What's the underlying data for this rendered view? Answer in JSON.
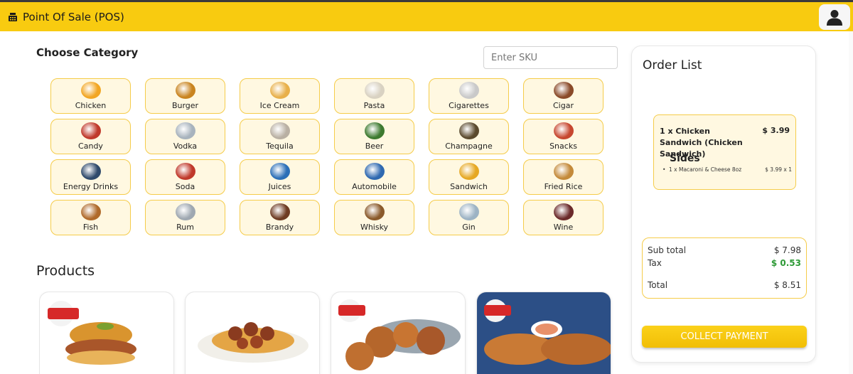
{
  "app": {
    "title": "Point Of Sale (POS)"
  },
  "categories_section": {
    "title": "Choose Category"
  },
  "search": {
    "placeholder": "Enter SKU",
    "value": ""
  },
  "categories": [
    {
      "label": "Chicken",
      "icon": "chicken-icon",
      "color": "#f2a623"
    },
    {
      "label": "Burger",
      "icon": "burger-icon",
      "color": "#c9841f"
    },
    {
      "label": "Ice Cream",
      "icon": "ice-cream-icon",
      "color": "#e8b04a"
    },
    {
      "label": "Pasta",
      "icon": "pasta-icon",
      "color": "#d9d2c2"
    },
    {
      "label": "Cigarettes",
      "icon": "cigarettes-icon",
      "color": "#c9c9c9"
    },
    {
      "label": "Cigar",
      "icon": "cigar-icon",
      "color": "#8a4a28"
    },
    {
      "label": "Candy",
      "icon": "candy-icon",
      "color": "#c0392b"
    },
    {
      "label": "Vodka",
      "icon": "vodka-icon",
      "color": "#a8b3bd"
    },
    {
      "label": "Tequila",
      "icon": "tequila-icon",
      "color": "#b9b0a3"
    },
    {
      "label": "Beer",
      "icon": "beer-icon",
      "color": "#3d7a2f"
    },
    {
      "label": "Champagne",
      "icon": "champagne-icon",
      "color": "#5b4a2e"
    },
    {
      "label": "Snacks",
      "icon": "snacks-icon",
      "color": "#c7472f"
    },
    {
      "label": "Energy Drinks",
      "icon": "energy-drinks-icon",
      "color": "#2f4a6b"
    },
    {
      "label": "Soda",
      "icon": "soda-icon",
      "color": "#c0392b"
    },
    {
      "label": "Juices",
      "icon": "juices-icon",
      "color": "#2c6fb7"
    },
    {
      "label": "Automobile",
      "icon": "automobile-icon",
      "color": "#2f69b0"
    },
    {
      "label": "Sandwich",
      "icon": "sandwich-icon",
      "color": "#e6a823"
    },
    {
      "label": "Fried Rice",
      "icon": "fried-rice-icon",
      "color": "#c48a3a"
    },
    {
      "label": "Fish",
      "icon": "fish-icon",
      "color": "#b06a2a"
    },
    {
      "label": "Rum",
      "icon": "rum-icon",
      "color": "#9fa8b1"
    },
    {
      "label": "Brandy",
      "icon": "brandy-icon",
      "color": "#6e3b22"
    },
    {
      "label": "Whisky",
      "icon": "whisky-icon",
      "color": "#8a5a2b"
    },
    {
      "label": "Gin",
      "icon": "gin-icon",
      "color": "#9db3c4"
    },
    {
      "label": "Wine",
      "icon": "wine-icon",
      "color": "#6b2a2a"
    }
  ],
  "products_section": {
    "title": "Products"
  },
  "products": [
    {
      "name": "chicken-sandwich",
      "icon": "chicken-sandwich-image"
    },
    {
      "name": "spaghetti-meatballs",
      "icon": "spaghetti-image"
    },
    {
      "name": "fried-chicken",
      "icon": "fried-chicken-image"
    },
    {
      "name": "chicken-tenders",
      "icon": "chicken-tenders-image"
    }
  ],
  "order": {
    "title": "Order List",
    "items": [
      {
        "name": "1 x Chicken Sandwich (Chicken Sandwich)",
        "price": "$ 3.99",
        "sides_label": "Sides",
        "sides": [
          {
            "bullet": "•",
            "name": "1 x Macaroni & Cheese 8oz",
            "price": "$ 3.99 x 1"
          }
        ]
      }
    ],
    "totals": {
      "subtotal_label": "Sub total",
      "subtotal": "$ 7.98",
      "tax_label": "Tax",
      "tax": "$ 0.53",
      "total_label": "Total",
      "total": "$ 8.51"
    },
    "collect_label": "COLLECT PAYMENT"
  },
  "colors": {
    "accent": "#f8cb10",
    "tax": "#2e9a37",
    "chip_bg": "#fff8e1",
    "chip_border": "#f5cc4a"
  }
}
